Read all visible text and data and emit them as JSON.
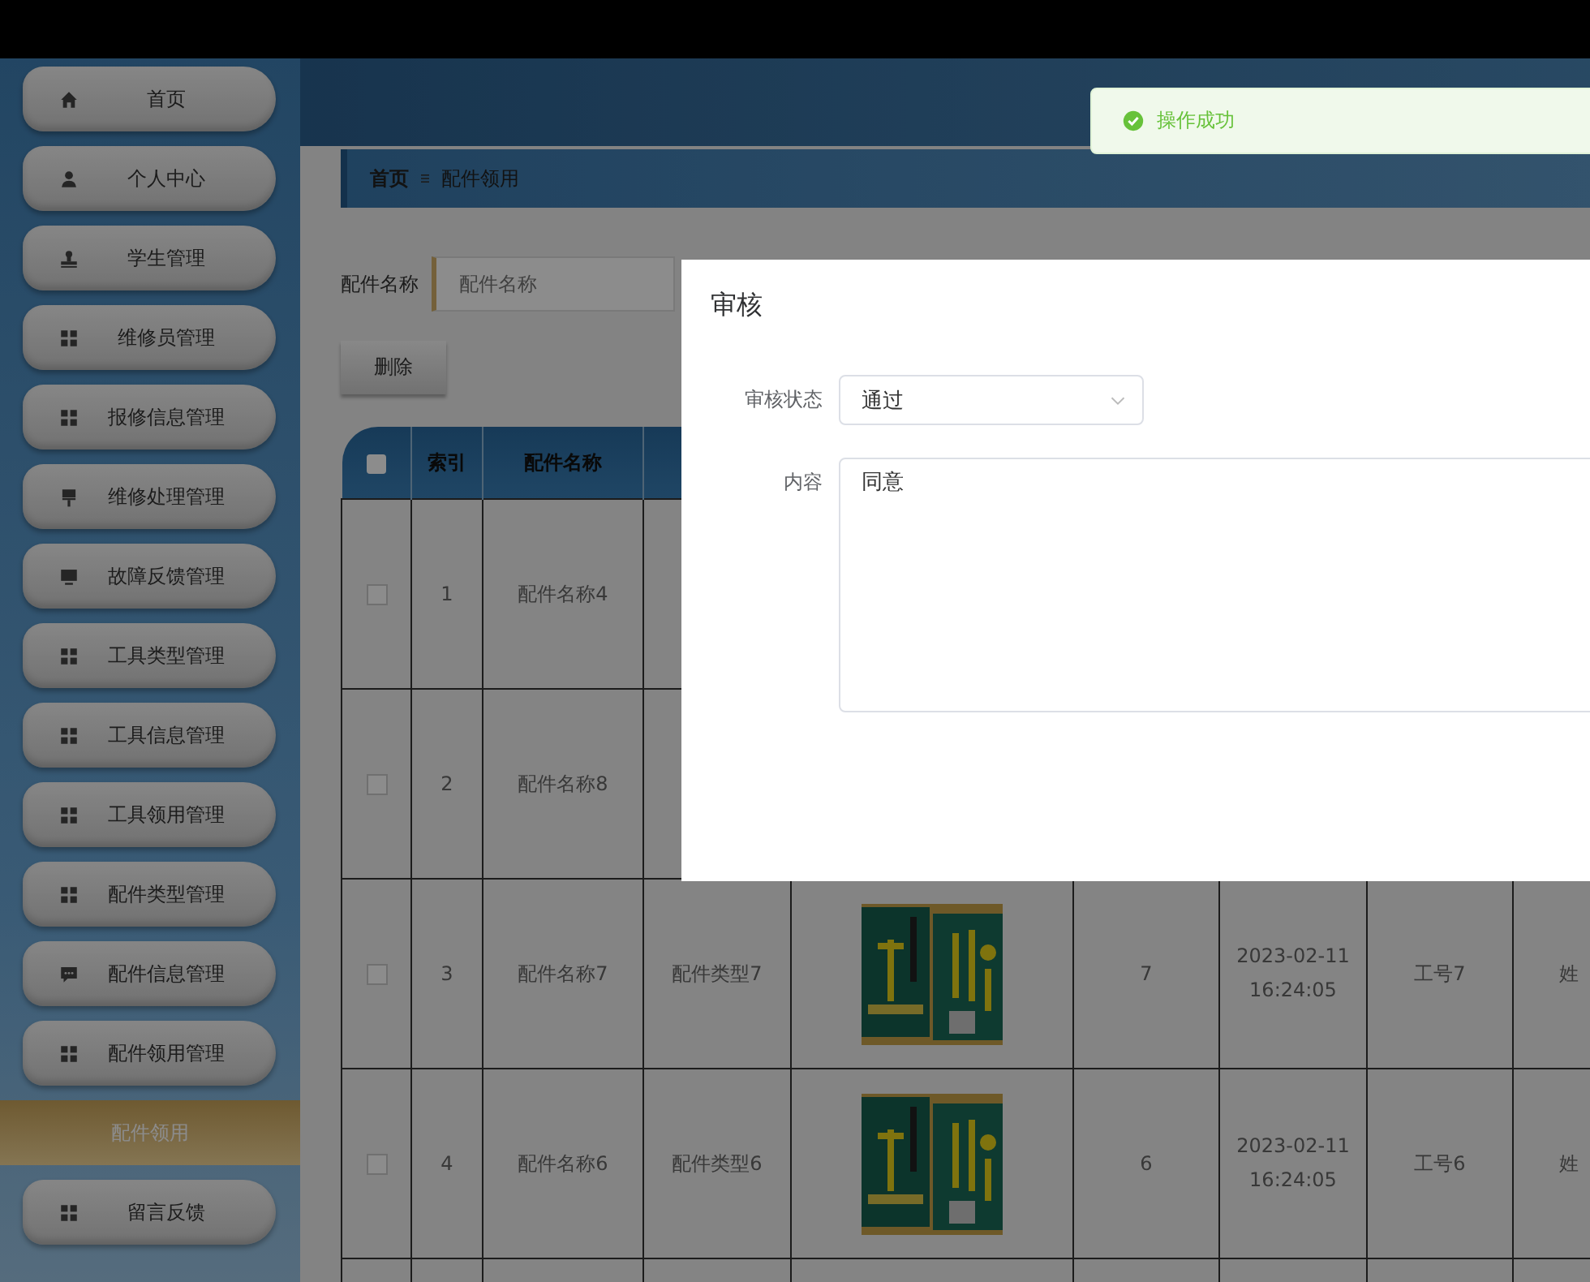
{
  "toast": {
    "text": "操作成功"
  },
  "sidebar": {
    "items": [
      {
        "label": "首页",
        "selected": false
      },
      {
        "label": "个人中心",
        "selected": false
      },
      {
        "label": "学生管理",
        "selected": false
      },
      {
        "label": "维修员管理",
        "selected": false
      },
      {
        "label": "报修信息管理",
        "selected": false
      },
      {
        "label": "维修处理管理",
        "selected": false
      },
      {
        "label": "故障反馈管理",
        "selected": false
      },
      {
        "label": "工具类型管理",
        "selected": false
      },
      {
        "label": "工具信息管理",
        "selected": false
      },
      {
        "label": "工具领用管理",
        "selected": false
      },
      {
        "label": "配件类型管理",
        "selected": false
      },
      {
        "label": "配件信息管理",
        "selected": false
      },
      {
        "label": "配件领用管理",
        "selected": false
      },
      {
        "label": "配件领用",
        "selected": true
      },
      {
        "label": "留言反馈",
        "selected": false
      }
    ]
  },
  "breadcrumb": [
    "首页",
    "配件领用"
  ],
  "search": {
    "label": "配件名称",
    "placeholder": "配件名称"
  },
  "delete_button": "删除",
  "table": {
    "columns": [
      {
        "kind": "checkbox",
        "checked": false
      },
      "索引",
      "配件名称"
    ],
    "rows": [
      {
        "cells": [
          {
            "kind": "checkbox",
            "checked": false
          },
          "1",
          "配件名称4"
        ]
      },
      {
        "cells": [
          {
            "kind": "checkbox",
            "checked": false
          },
          "2",
          "配件名称8"
        ]
      },
      {
        "cells": [
          {
            "kind": "checkbox",
            "checked": false
          },
          "3",
          "配件名称7",
          "配件类型7",
          {
            "kind": "picture"
          },
          "7",
          "2023-02-11 16:24:05",
          "工号7",
          "姓"
        ]
      },
      {
        "cells": [
          {
            "kind": "checkbox",
            "checked": false
          },
          "4",
          "配件名称6",
          "配件类型6",
          {
            "kind": "picture"
          },
          "6",
          "2023-02-11 16:24:05",
          "工号6",
          "姓"
        ]
      }
    ]
  },
  "dialog": {
    "title": "审核",
    "fields": [
      {
        "kind": "select",
        "label": "审核状态",
        "value": "通过"
      },
      {
        "kind": "textarea",
        "label": "内容",
        "value": "同意"
      }
    ]
  }
}
